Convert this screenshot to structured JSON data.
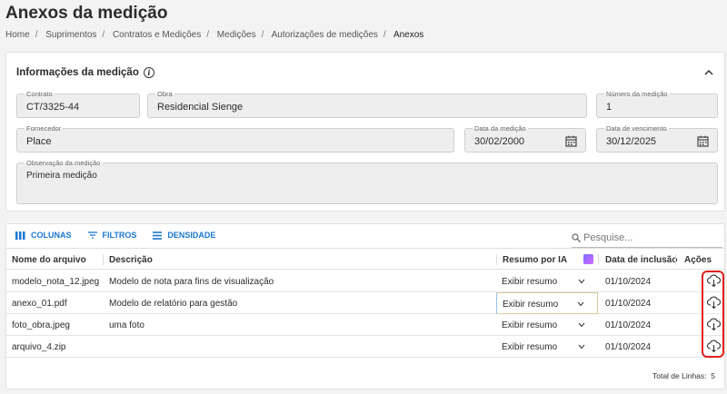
{
  "page": {
    "title": "Anexos da medição"
  },
  "breadcrumb": [
    "Home",
    "Suprimentos",
    "Contratos e Medições",
    "Medições",
    "Autorizações de medições",
    "Anexos"
  ],
  "info": {
    "title": "Informações da medição",
    "fields": {
      "contrato": {
        "label": "Contrato",
        "value": "CT/3325-44"
      },
      "obra": {
        "label": "Obra",
        "value": "Residencial Sienge"
      },
      "numero": {
        "label": "Número da medição",
        "value": "1"
      },
      "fornecedor": {
        "label": "Fornecedor",
        "value": "Place"
      },
      "data_medicao": {
        "label": "Data da medição",
        "value": "30/02/2000"
      },
      "data_vencimento": {
        "label": "Data de vencimento",
        "value": "30/12/2025"
      },
      "observacao": {
        "label": "Observação da medição",
        "value": "Primeira medição"
      }
    }
  },
  "toolbar": {
    "columns": "COLUNAS",
    "filters": "FILTROS",
    "density": "DENSIDADE"
  },
  "search": {
    "placeholder": "Pesquise..."
  },
  "table": {
    "headers": {
      "name": "Nome do arquivo",
      "desc": "Descrição",
      "resumo": "Resumo por IA",
      "date": "Data de inclusão",
      "actions": "Ações"
    },
    "rows": [
      {
        "name": "modelo_nota_12.jpeg",
        "desc": "Modelo de nota para fins de visualização",
        "resumo": "Exibir resumo",
        "date": "01/10/2024"
      },
      {
        "name": "anexo_01.pdf",
        "desc": "Modelo de relatório para gestão",
        "resumo": "Exibir resumo",
        "date": "01/10/2024"
      },
      {
        "name": "foto_obra.jpeg",
        "desc": "uma foto",
        "resumo": "Exibir resumo",
        "date": "01/10/2024"
      },
      {
        "name": "arquivo_4.zip",
        "desc": "",
        "resumo": "Exibir resumo",
        "date": "01/10/2024"
      }
    ],
    "total_label": "Total de Linhas:",
    "total_value": "5"
  },
  "colors": {
    "accent": "#1976d2",
    "highlight": "#e02020"
  }
}
